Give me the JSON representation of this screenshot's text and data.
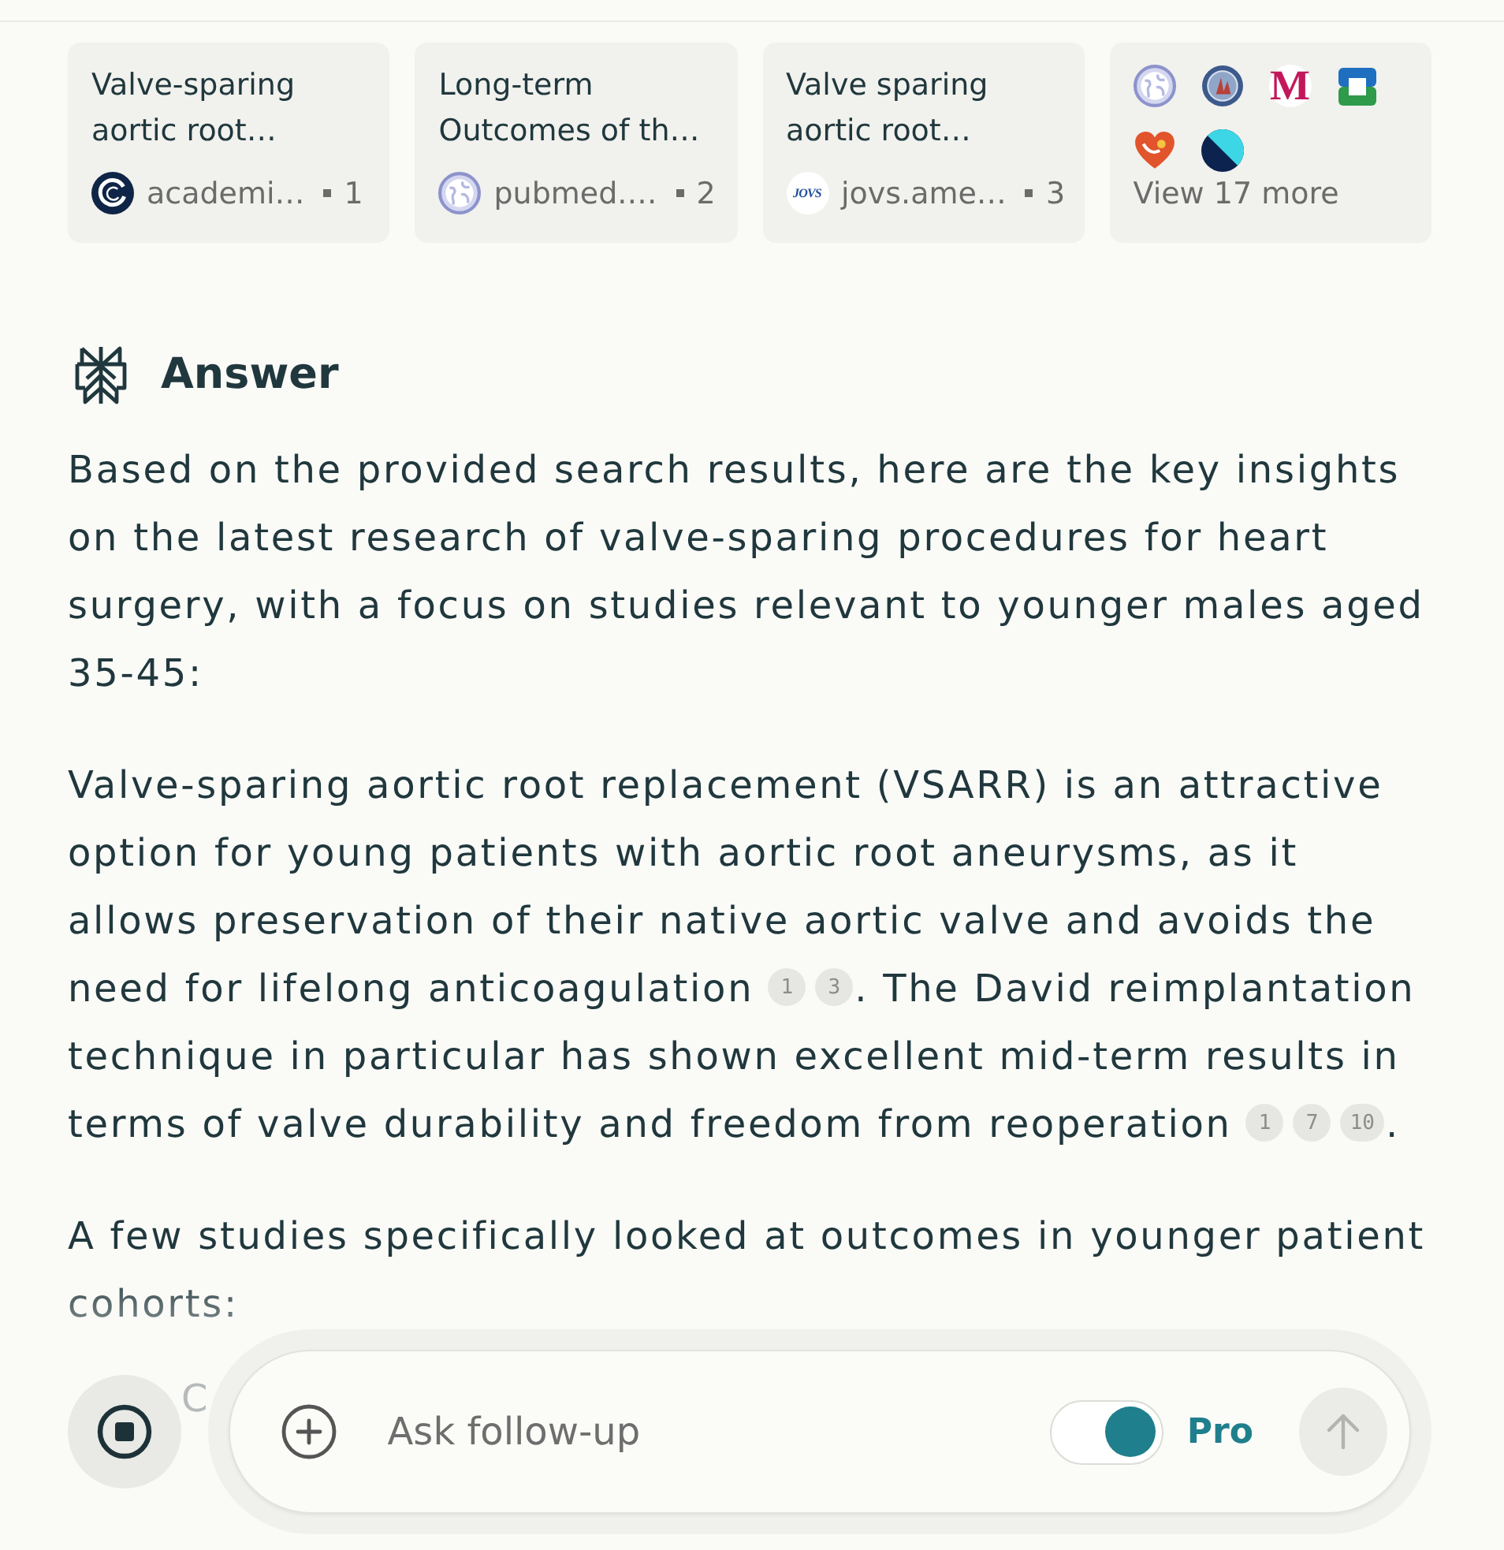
{
  "sources": [
    {
      "title": "Valve-sparing aortic root…",
      "site": "academi…",
      "index": "1",
      "icon": {
        "kind": "swirl"
      }
    },
    {
      "title": "Long-term Outcomes of th…",
      "site": "pubmed.…",
      "index": "2",
      "icon": {
        "kind": "globe"
      }
    },
    {
      "title": "Valve sparing aortic root…",
      "site": "jovs.ame…",
      "index": "3",
      "icon": {
        "kind": "letters",
        "text": "JOVS",
        "color": "#1f4e9a"
      }
    }
  ],
  "more_sources": {
    "icons": [
      {
        "kind": "globe"
      },
      {
        "kind": "seal"
      },
      {
        "kind": "letters",
        "text": "M",
        "color": "#c2185b"
      },
      {
        "kind": "cross"
      },
      {
        "kind": "heart"
      },
      {
        "kind": "split"
      }
    ],
    "label": "View 17 more"
  },
  "answer": {
    "heading": "Answer",
    "paragraphs": [
      {
        "segments": [
          {
            "kind": "text",
            "text": "Based on the provided search results, here are the key insights on the latest research of valve-sparing procedures for heart surgery, with a focus on studies relevant to younger males aged 35-45:"
          }
        ]
      },
      {
        "segments": [
          {
            "kind": "text",
            "text": "Valve-sparing aortic root replacement (VSARR) is an attractive option for young patients with aortic root aneurysms, as it allows preservation of their native aortic valve and avoids the need for lifelong anticoagulation"
          },
          {
            "kind": "citations",
            "refs": [
              "1",
              "3"
            ]
          },
          {
            "kind": "text",
            "text": ". The David reimplantation technique in particular has shown excellent mid-term results in terms of valve durability and freedom from reoperation"
          },
          {
            "kind": "citations",
            "refs": [
              "1",
              "7",
              "10"
            ]
          },
          {
            "kind": "text",
            "text": "."
          }
        ]
      },
      {
        "segments": [
          {
            "kind": "text",
            "text": "A few studies specifically looked at outcomes in younger patient cohorts:"
          }
        ]
      }
    ],
    "partial_text": "C"
  },
  "follow_up": {
    "placeholder": "Ask follow-up",
    "pro": {
      "label": "Pro",
      "on": true
    },
    "send_disabled": true
  }
}
